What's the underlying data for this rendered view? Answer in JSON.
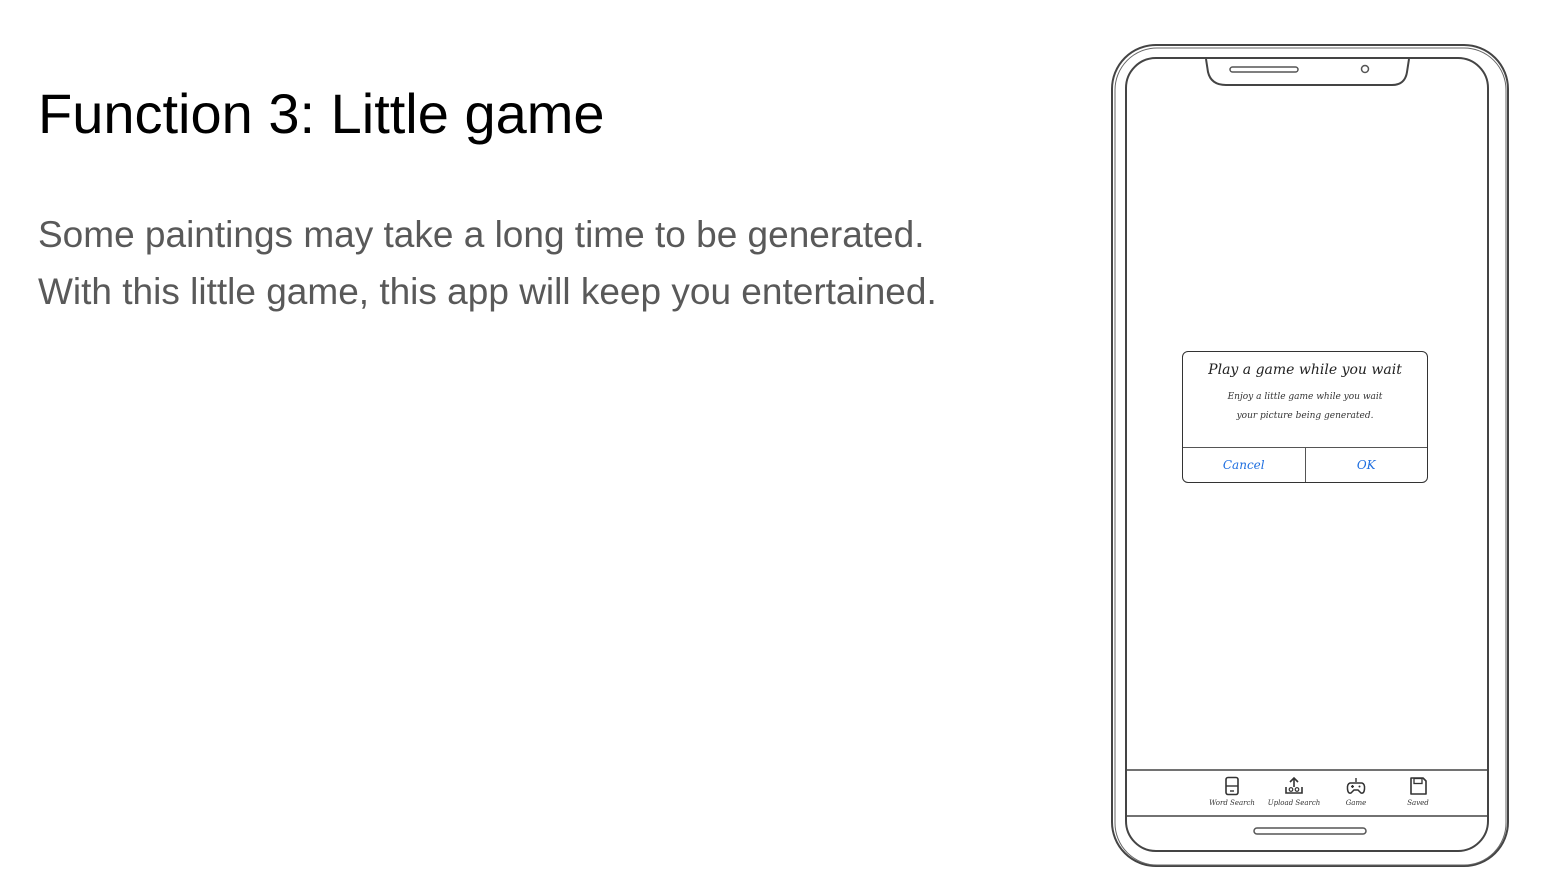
{
  "slide": {
    "title": "Function 3: Little game",
    "body_lines": [
      "Some paintings may take a long time to be generated.",
      "With this little game, this app will keep you entertained."
    ]
  },
  "mockup": {
    "dialog": {
      "title": "Play a game while you wait",
      "message_lines": [
        "Enjoy a little game while you wait",
        "your picture being generated."
      ],
      "cancel_label": "Cancel",
      "ok_label": "OK"
    },
    "tab_bar": {
      "items": [
        {
          "label": "Word Search",
          "icon": "phone-icon"
        },
        {
          "label": "Upload Search",
          "icon": "upload-icon"
        },
        {
          "label": "Game",
          "icon": "gamepad-icon"
        },
        {
          "label": "Saved",
          "icon": "save-icon"
        }
      ]
    },
    "colors": {
      "link_blue": "#1f6fe0",
      "sketch_line": "#333333"
    }
  }
}
